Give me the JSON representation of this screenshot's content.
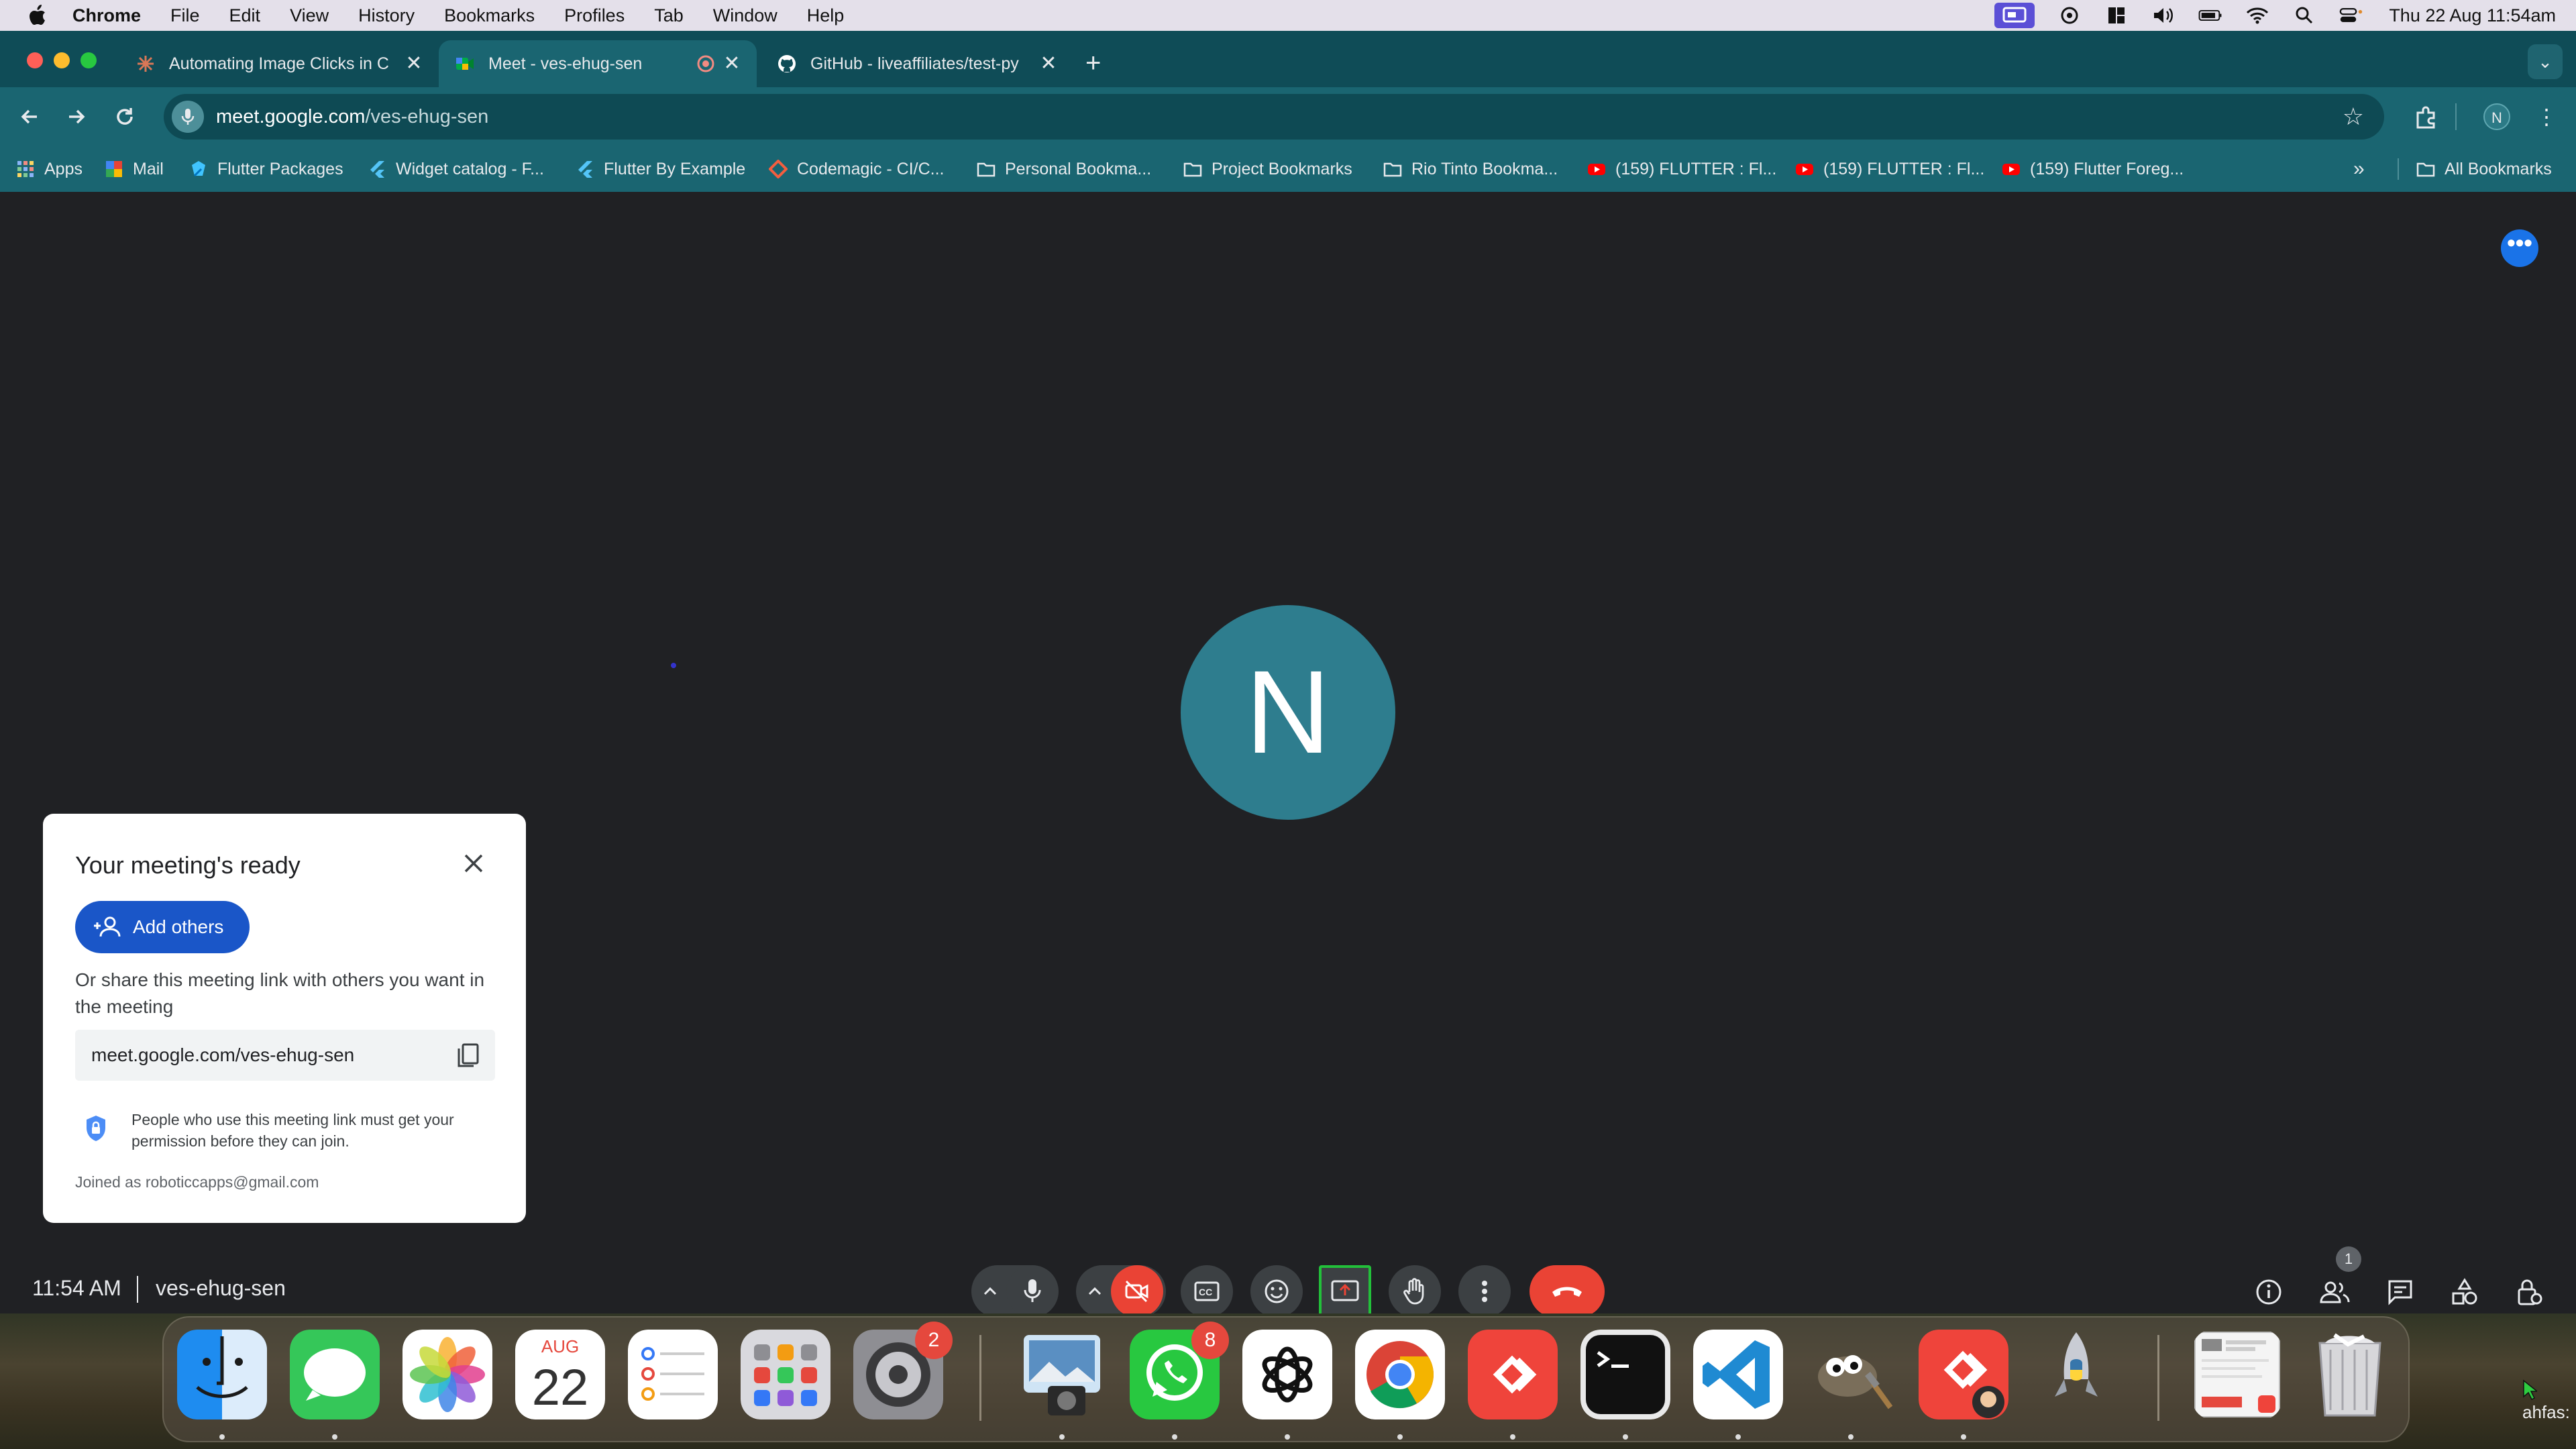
{
  "menubar": {
    "app": "Chrome",
    "items": [
      "File",
      "Edit",
      "View",
      "History",
      "Bookmarks",
      "Profiles",
      "Tab",
      "Window",
      "Help"
    ],
    "clock": "Thu 22 Aug  11:54am"
  },
  "tabs": [
    {
      "title": "Automating Image Clicks in C",
      "close": "✕"
    },
    {
      "title": "Meet - ves-ehug-sen",
      "close": "✕"
    },
    {
      "title": "GitHub - liveaffiliates/test-py",
      "close": "✕"
    }
  ],
  "new_tab": "+",
  "address": {
    "host": "meet.google.com",
    "path": "/ves-ehug-sen"
  },
  "profile_initial": "N",
  "bookmarks": {
    "items": [
      "Apps",
      "Mail",
      "Flutter Packages",
      "Widget catalog - F...",
      "Flutter By Example",
      "Codemagic - CI/C...",
      "Personal Bookma...",
      "Project Bookmarks",
      "Rio Tinto Bookma...",
      "(159) FLUTTER : Fl...",
      "(159) FLUTTER : Fl...",
      "(159) Flutter Foreg..."
    ],
    "more": "»",
    "all": "All Bookmarks"
  },
  "meet": {
    "avatar_initial": "N",
    "more_dots": "•••",
    "card": {
      "title": "Your meeting's ready",
      "add_button": "Add others",
      "share_text": "Or share this meeting link with others you want in the meeting",
      "link": "meet.google.com/ves-ehug-sen",
      "permission_text": "People who use this meeting link must get your permission before they can join.",
      "joined": "Joined as roboticcapps@gmail.com"
    },
    "time": "11:54 AM",
    "meeting_code": "ves-ehug-sen",
    "participants_count": "1"
  },
  "dock": {
    "settings_badge": "2",
    "whatsapp_badge": "8",
    "desktop_text": "ahfas:"
  },
  "colors": {
    "tab_bar": "#0f4c57",
    "toolbar": "#1a6571",
    "meet_bg": "#202124",
    "end_call": "#ea4335",
    "add_button": "#1a56c8",
    "avatar": "#2e7d8e"
  }
}
